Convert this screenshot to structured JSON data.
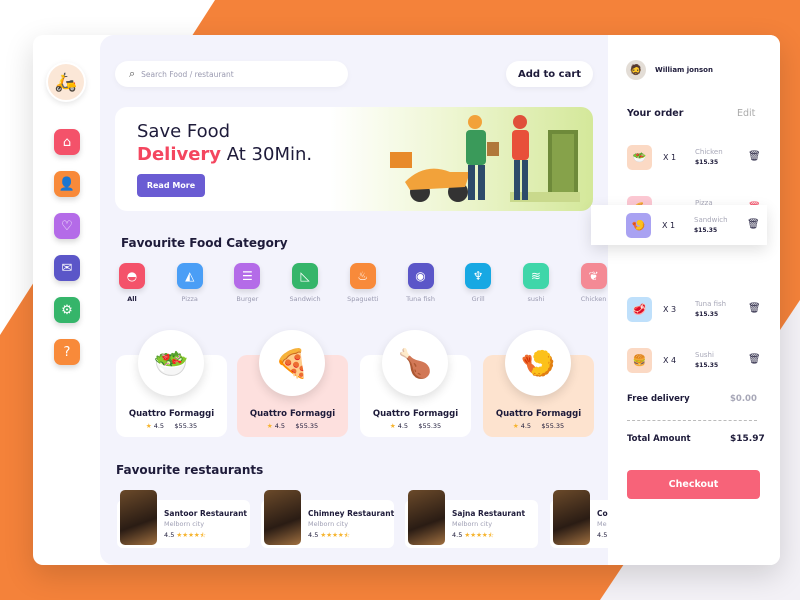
{
  "user": {
    "name": "William jonson"
  },
  "search": {
    "placeholder": "Search Food / restaurant"
  },
  "header": {
    "add_to_cart": "Add to cart"
  },
  "banner": {
    "line1": "Save Food",
    "highlight": "Delivery",
    "line2_rest": " At 30Min.",
    "button": "Read More"
  },
  "categories_title": "Favourite Food Category",
  "categories": [
    {
      "label": "All",
      "color": "#f4526a",
      "icon": "cloche-icon"
    },
    {
      "label": "Pizza",
      "color": "#4a9ef6",
      "icon": "pizza-icon"
    },
    {
      "label": "Burger",
      "color": "#b46be8",
      "icon": "burger-icon"
    },
    {
      "label": "Sandwich",
      "color": "#35b56a",
      "icon": "sandwich-icon"
    },
    {
      "label": "Spaguetti",
      "color": "#f88a3a",
      "icon": "spaghetti-icon"
    },
    {
      "label": "Tuna fish",
      "color": "#5b56c8",
      "icon": "fish-icon"
    },
    {
      "label": "Grill",
      "color": "#17a8e3",
      "icon": "grill-icon"
    },
    {
      "label": "sushi",
      "color": "#3fd6a9",
      "icon": "sushi-icon"
    },
    {
      "label": "Chicken",
      "color": "#f48a95",
      "icon": "chicken-icon"
    }
  ],
  "foods": [
    {
      "name": "Quattro Formaggi",
      "rating": "4.5",
      "price": "$55.35",
      "bg": "#ffffff",
      "emoji": "🥗"
    },
    {
      "name": "Quattro Formaggi",
      "rating": "4.5",
      "price": "$55.35",
      "bg": "#fde0de",
      "emoji": "🍕"
    },
    {
      "name": "Quattro Formaggi",
      "rating": "4.5",
      "price": "$55.35",
      "bg": "#ffffff",
      "emoji": "🍗"
    },
    {
      "name": "Quattro Formaggi",
      "rating": "4.5",
      "price": "$55.35",
      "bg": "#fde3cf",
      "emoji": "🍤"
    }
  ],
  "restaurants_title": "Favourite restaurants",
  "restaurants": [
    {
      "name": "Santoor Restaurant",
      "city": "Melborn city",
      "rating": "4.5"
    },
    {
      "name": "Chimney Restaurant",
      "city": "Melborn city",
      "rating": "4.5"
    },
    {
      "name": "Sajna Restaurant",
      "city": "Melborn city",
      "rating": "4.5"
    },
    {
      "name": "Co",
      "city": "Me",
      "rating": "4.5"
    }
  ],
  "order": {
    "title": "Your order",
    "edit": "Edit",
    "items": [
      {
        "qty": "X  1",
        "name": "Chicken",
        "price": "$15.35",
        "bg": "#fbd9c4",
        "emoji": "🥗"
      },
      {
        "qty": "X  2",
        "name": "Pizza",
        "price": "$15.35",
        "bg": "#fcc8d3",
        "emoji": "🍕"
      },
      {
        "qty": "X  1",
        "name": "Sandwich",
        "price": "$15.35",
        "bg": "#a9a2f2",
        "emoji": "🍤"
      },
      {
        "qty": "X  3",
        "name": "Tuna fish",
        "price": "$15.35",
        "bg": "#bfe0fb",
        "emoji": "🥩"
      },
      {
        "qty": "X  4",
        "name": "Sushi",
        "price": "$15.35",
        "bg": "#fbd9c4",
        "emoji": "🍔"
      }
    ],
    "free_delivery": "Free delivery",
    "free_delivery_value": "$0.00",
    "total_label": "Total Amount",
    "total_value": "$15.97",
    "checkout": "Checkout"
  },
  "colors": {
    "accent": "#f4823a",
    "primary": "#6a5cd3",
    "highlight": "#f4465f",
    "checkout": "#f76379"
  }
}
